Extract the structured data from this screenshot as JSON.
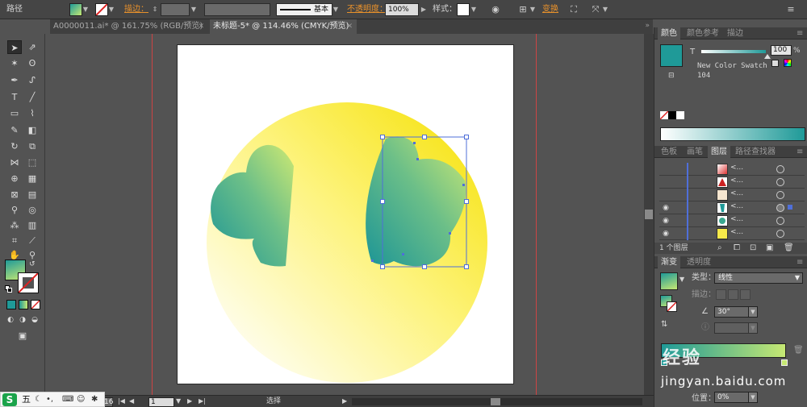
{
  "control_bar": {
    "object_type": "路径",
    "stroke_label": "描边：",
    "stroke_style": "基本",
    "opacity_label": "不透明度：",
    "opacity_value": "100%",
    "style_label": "样式：",
    "transform_label": "变换"
  },
  "tabs": [
    {
      "label": "A0000011.ai* @ 161.75% (RGB/预览)"
    },
    {
      "label": "未标题-5* @ 114.46% (CMYK/预览)"
    }
  ],
  "color_panel": {
    "tabs": [
      "颜色",
      "颜色参考",
      "描边"
    ],
    "tint_label": "T",
    "tint_value": "100",
    "tint_unit": "%",
    "swatch_name": "New Color Swatch",
    "swatch_number": "104",
    "swatch_color": "#1f9a98"
  },
  "layers_panel": {
    "tabs": [
      "色板",
      "画笔",
      "图层",
      "路径查找器"
    ],
    "rows": [
      {
        "name": "<...",
        "visible": false
      },
      {
        "name": "<...",
        "visible": false
      },
      {
        "name": "<...",
        "visible": false
      },
      {
        "name": "<...",
        "visible": true
      },
      {
        "name": "<...",
        "visible": true
      },
      {
        "name": "<...",
        "visible": true
      }
    ],
    "footer_count": "1 个图层"
  },
  "gradient_panel": {
    "tabs": [
      "渐变",
      "透明度"
    ],
    "type_label": "类型：",
    "type_value": "线性",
    "stroke_label": "描边：",
    "angle_value": "30°",
    "location_label": "位置：",
    "location_value": "0%",
    "start_color": "#1f9a98",
    "end_color": "#c6e873"
  },
  "statusbar": {
    "zoom_value": "16",
    "artboard_value": "1",
    "tool_label": "选择"
  },
  "watermark": {
    "text1": "经验",
    "text2": "jingyan.baidu.com"
  },
  "ime": {
    "label": "五"
  },
  "colors": {
    "yellow": "#f7e51c",
    "teal": "#1f9a98",
    "lime": "#c6e873",
    "selection": "#4f6fd9"
  }
}
